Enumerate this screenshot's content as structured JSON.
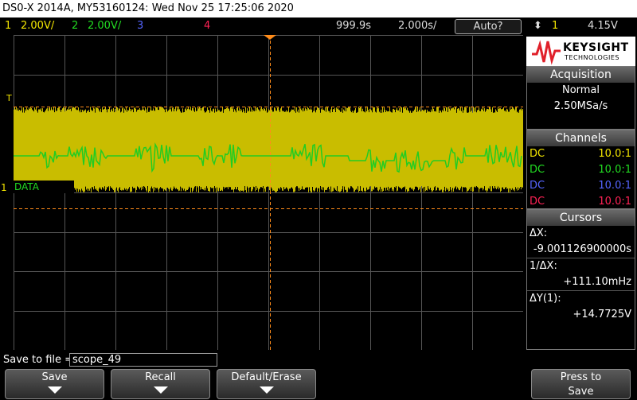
{
  "titlebar": {
    "text": "DS0-X 2014A, MY53160124: Wed Nov 25 17:25:06 2020"
  },
  "statusbar": {
    "ch1_num": "1",
    "ch1_scale": "2.00V/",
    "ch2_num": "2",
    "ch2_scale": "2.00V/",
    "ch3_num": "3",
    "ch4_num": "4",
    "time_delay": "999.9s",
    "time_scale": "2.000s/",
    "run_mode": "Auto?",
    "trigger_icon": "trigger-updown-icon",
    "trig_source": "1",
    "trig_level": "4.15V"
  },
  "display": {
    "trigger_marker": "T",
    "ch1_marker": "1",
    "data_label": "DATA"
  },
  "logo": {
    "brand": "KEYSIGHT",
    "sub": "TECHNOLOGIES"
  },
  "acquisition": {
    "header": "Acquisition",
    "mode": "Normal",
    "rate": "2.50MSa/s"
  },
  "channels": {
    "header": "Channels",
    "rows": [
      {
        "coupling": "DC",
        "ratio": "10.0:1",
        "color": "#f4e600"
      },
      {
        "coupling": "DC",
        "ratio": "10.0:1",
        "color": "#22dd22"
      },
      {
        "coupling": "DC",
        "ratio": "10.0:1",
        "color": "#5565ff"
      },
      {
        "coupling": "DC",
        "ratio": "10.0:1",
        "color": "#ff2255"
      }
    ]
  },
  "cursors": {
    "header": "Cursors",
    "dx_label": "ΔX:",
    "dx_value": "-9.001126900000s",
    "inv_dx_label": "1/ΔX:",
    "inv_dx_value": "+111.10mHz",
    "dy_label": "ΔY(1):",
    "dy_value": "+14.7725V"
  },
  "save": {
    "label": "Save to file =",
    "filename": "scope_49"
  },
  "softkeys": {
    "save": "Save",
    "recall": "Recall",
    "default": "Default/Erase",
    "press1": "Press to",
    "press2": "Save"
  }
}
